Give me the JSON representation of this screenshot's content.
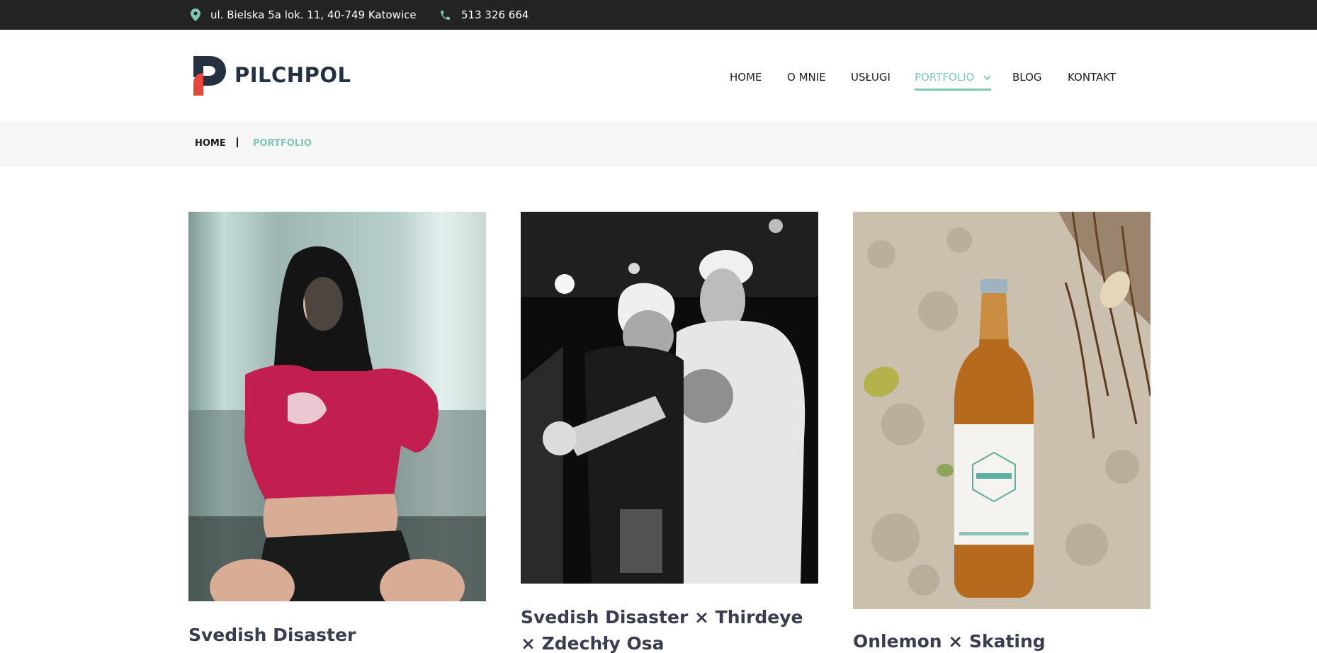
{
  "topbar": {
    "address": "ul. Bielska 5a lok. 11, 40-749 Katowice",
    "phone": "513 326 664"
  },
  "brand": {
    "name": "PILCHPOL",
    "accent": "#7ec6b8",
    "logo_red": "#e4473b",
    "logo_dark": "#253040"
  },
  "nav": {
    "items": [
      "HOME",
      "O MNIE",
      "USŁUGI",
      "PORTFOLIO",
      "BLOG",
      "KONTAKT"
    ],
    "active": "PORTFOLIO"
  },
  "breadcrumb": {
    "home": "HOME",
    "current": "PORTFOLIO"
  },
  "portfolio": {
    "items": [
      {
        "title": "Svedish Disaster",
        "icon": "photo-woman-red-sweater"
      },
      {
        "title": "Svedish Disaster × Thirdeye × Zdechły Osa",
        "icon": "photo-two-men-bw"
      },
      {
        "title": "Onlemon × Skating",
        "icon": "photo-bottle-on-sand"
      }
    ]
  }
}
